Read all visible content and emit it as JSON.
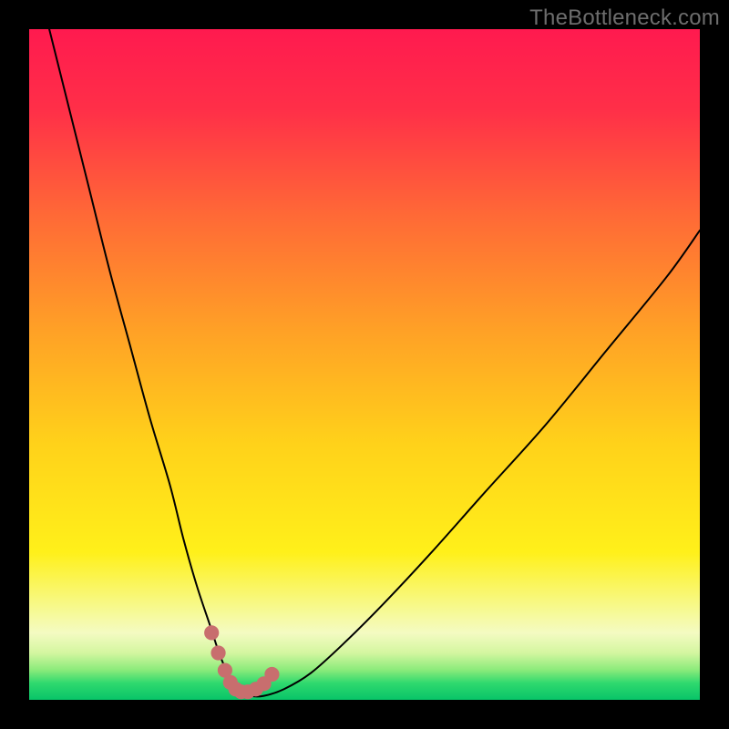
{
  "watermark": "TheBottleneck.com",
  "colors": {
    "frame": "#000000",
    "curve": "#000000",
    "marker_fill": "#c86e6e",
    "gradient_stops": [
      {
        "offset": 0.0,
        "color": "#ff1a4f"
      },
      {
        "offset": 0.12,
        "color": "#ff2f48"
      },
      {
        "offset": 0.28,
        "color": "#ff6a36"
      },
      {
        "offset": 0.45,
        "color": "#ffa126"
      },
      {
        "offset": 0.62,
        "color": "#ffd21a"
      },
      {
        "offset": 0.78,
        "color": "#fff01a"
      },
      {
        "offset": 0.86,
        "color": "#f7f98a"
      },
      {
        "offset": 0.9,
        "color": "#f4fbc2"
      },
      {
        "offset": 0.93,
        "color": "#d4f6a0"
      },
      {
        "offset": 0.955,
        "color": "#8ceb7b"
      },
      {
        "offset": 0.975,
        "color": "#2fd96e"
      },
      {
        "offset": 1.0,
        "color": "#08c468"
      }
    ]
  },
  "chart_data": {
    "type": "line",
    "title": "",
    "xlabel": "",
    "ylabel": "",
    "xlim": [
      0,
      100
    ],
    "ylim": [
      0,
      100
    ],
    "grid": false,
    "legend": false,
    "series": [
      {
        "name": "bottleneck-curve",
        "x": [
          3,
          6,
          9,
          12,
          15,
          18,
          21,
          23,
          25,
          27,
          28.5,
          30,
          31.5,
          33,
          35,
          38,
          42,
          47,
          53,
          60,
          68,
          77,
          86,
          95,
          100
        ],
        "y": [
          100,
          88,
          76,
          64,
          53,
          42,
          32,
          24,
          17,
          11,
          6.5,
          3.2,
          1.4,
          0.6,
          0.6,
          1.6,
          4.0,
          8.5,
          14.5,
          22,
          31,
          41,
          52,
          63,
          70
        ]
      }
    ],
    "markers": {
      "name": "trough-markers",
      "x": [
        27.2,
        28.2,
        29.2,
        30.0,
        30.8,
        31.6,
        32.6,
        33.8,
        35.0,
        36.2
      ],
      "y": [
        10.0,
        7.0,
        4.4,
        2.6,
        1.6,
        1.2,
        1.2,
        1.6,
        2.4,
        3.8
      ],
      "r": 1.1
    }
  }
}
